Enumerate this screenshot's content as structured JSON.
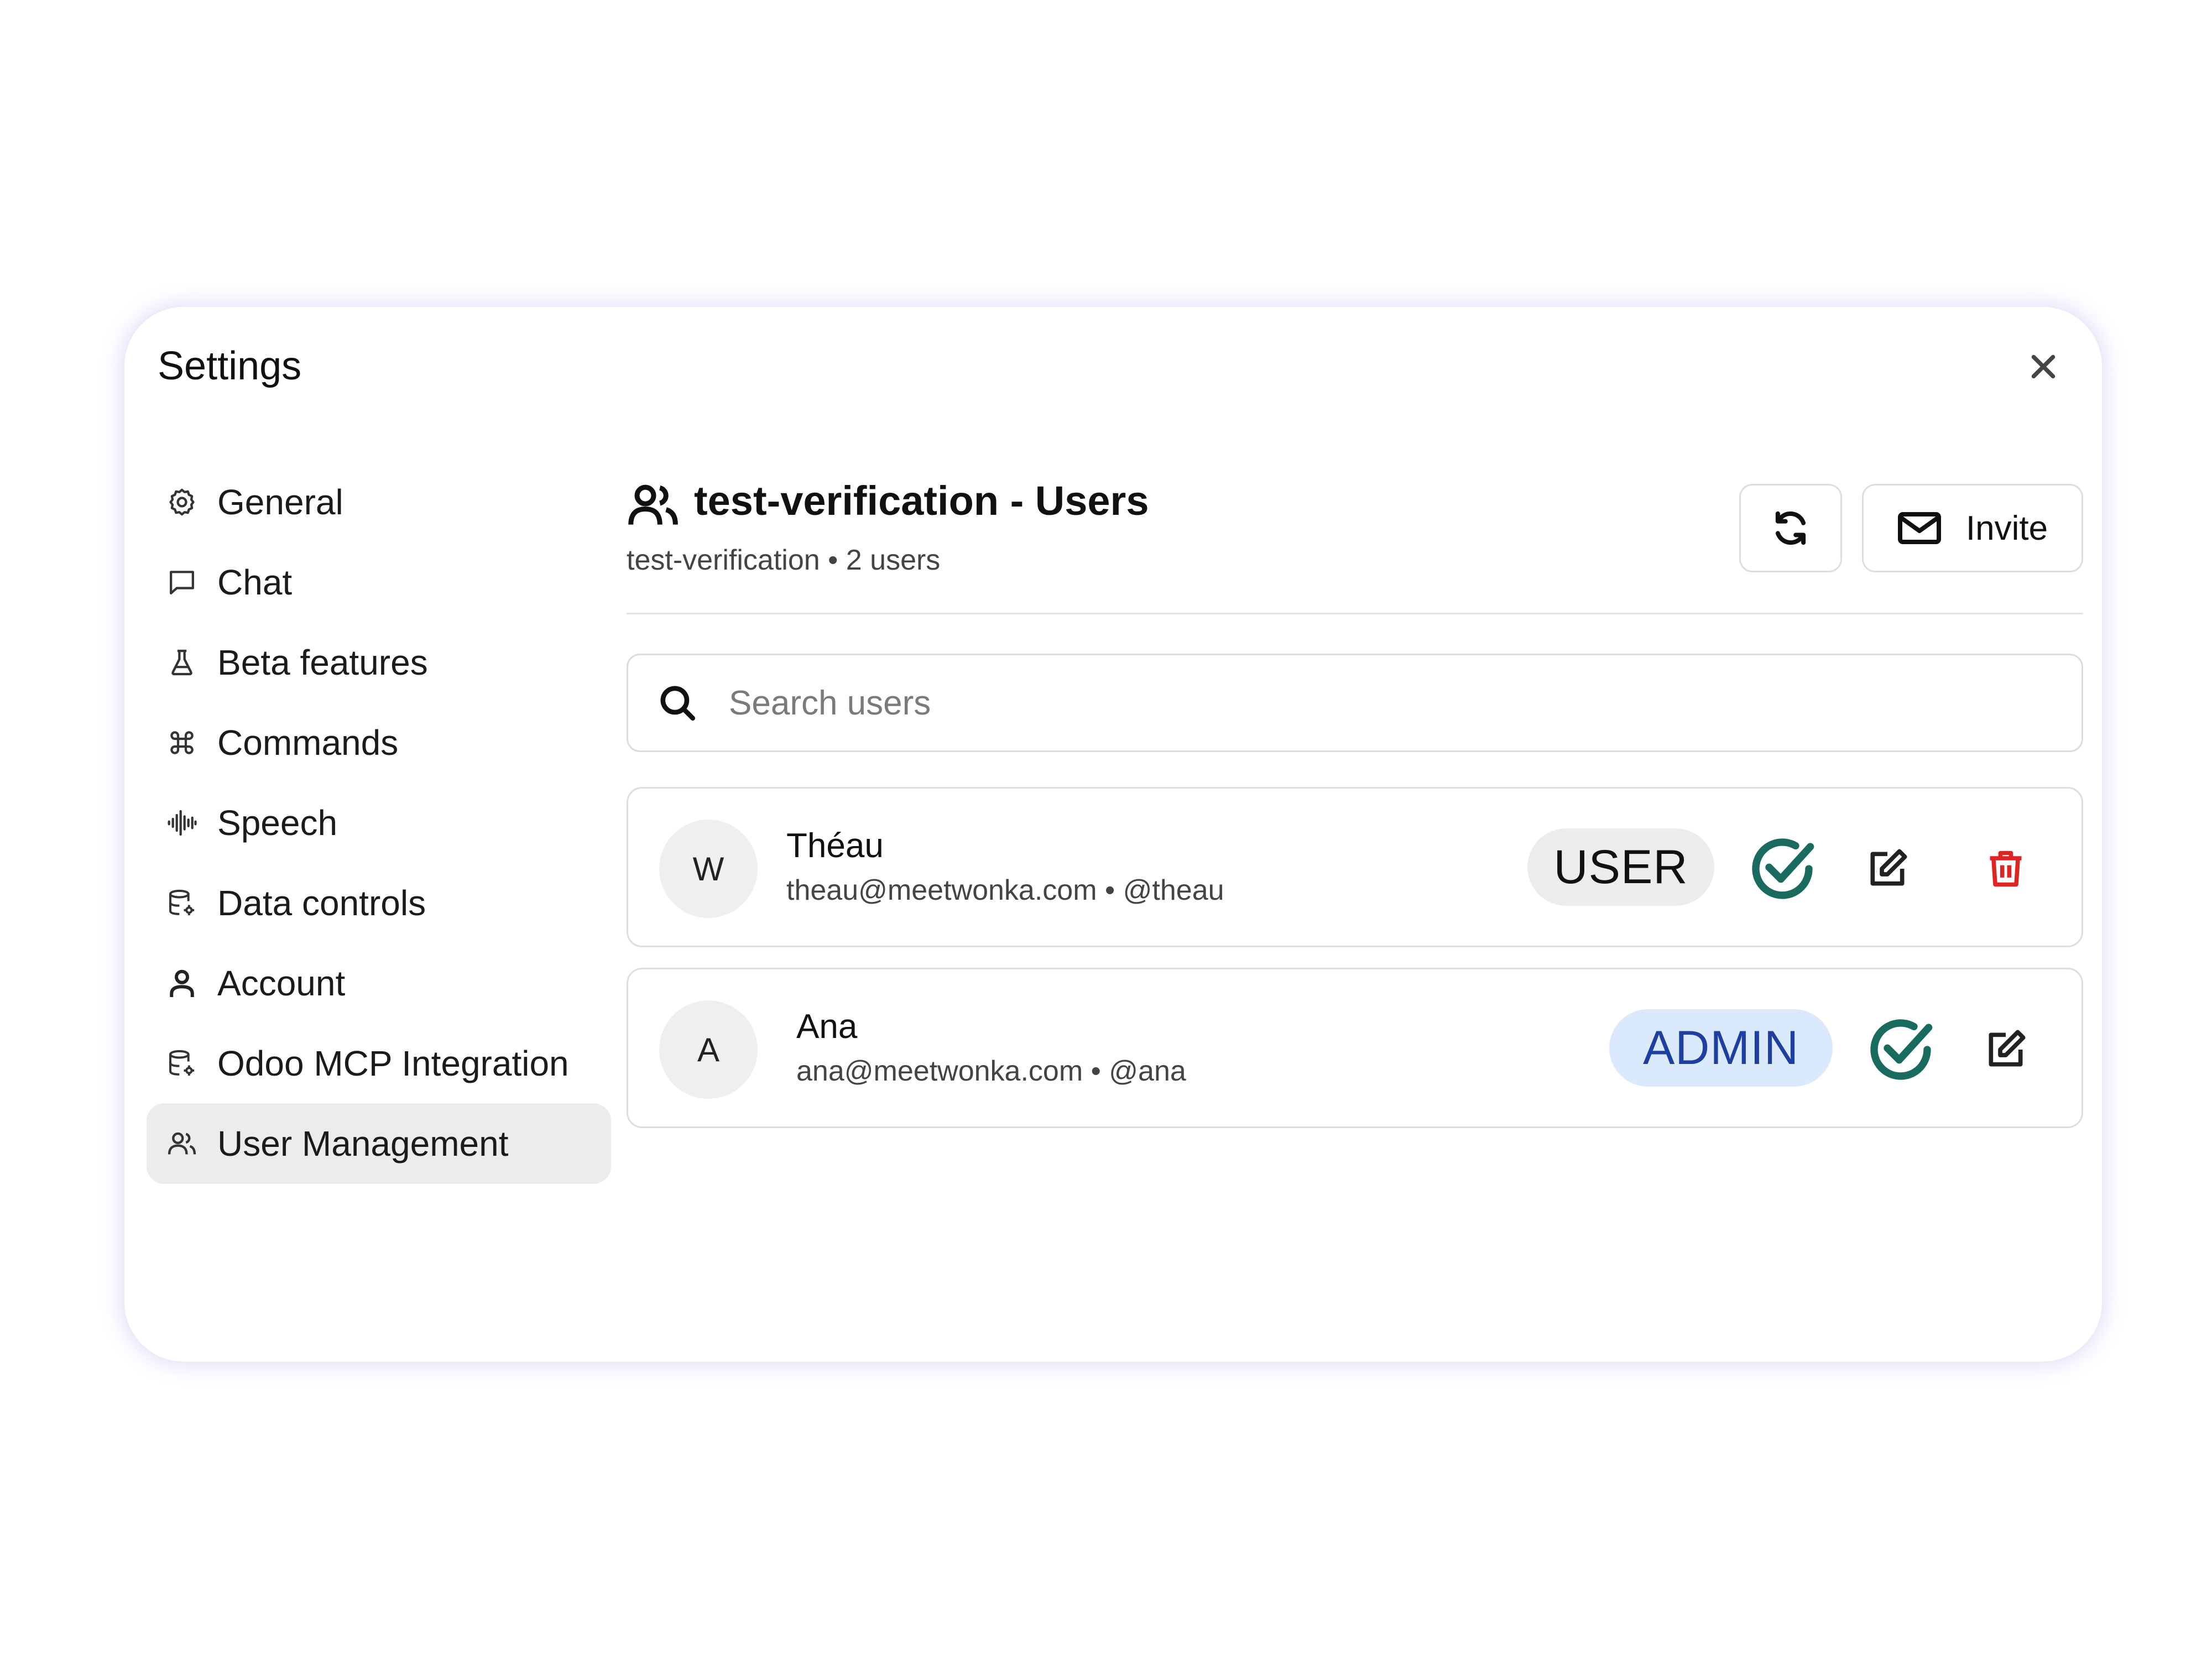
{
  "modal": {
    "title": "Settings"
  },
  "sidebar": {
    "items": [
      {
        "label": "General",
        "icon": "gear-icon"
      },
      {
        "label": "Chat",
        "icon": "chat-bubble-icon"
      },
      {
        "label": "Beta features",
        "icon": "flask-icon"
      },
      {
        "label": "Commands",
        "icon": "command-icon"
      },
      {
        "label": "Speech",
        "icon": "waveform-icon"
      },
      {
        "label": "Data controls",
        "icon": "database-gear-icon"
      },
      {
        "label": "Account",
        "icon": "person-icon"
      },
      {
        "label": "Odoo MCP Integration",
        "icon": "database-gear-icon"
      },
      {
        "label": "User Management",
        "icon": "users-icon",
        "active": true
      }
    ]
  },
  "main": {
    "title": "test-verification - Users",
    "subtitle": "test-verification • 2 users",
    "invite_label": "Invite",
    "search_placeholder": "Search users"
  },
  "users": [
    {
      "initial": "W",
      "name": "Théau",
      "meta": "theau@meetwonka.com • @theau",
      "role": "USER",
      "can_delete": true
    },
    {
      "initial": "A",
      "name": "Ana",
      "meta": "ana@meetwonka.com • @ana",
      "role": "ADMIN",
      "can_delete": false
    }
  ],
  "colors": {
    "accent_verified": "#1a6b5f",
    "delete_red": "#e02424",
    "admin_badge_bg": "#dbe9fd",
    "admin_badge_text": "#1f3fa0",
    "user_badge_bg": "#ececec",
    "active_nav_bg": "#ececec"
  }
}
